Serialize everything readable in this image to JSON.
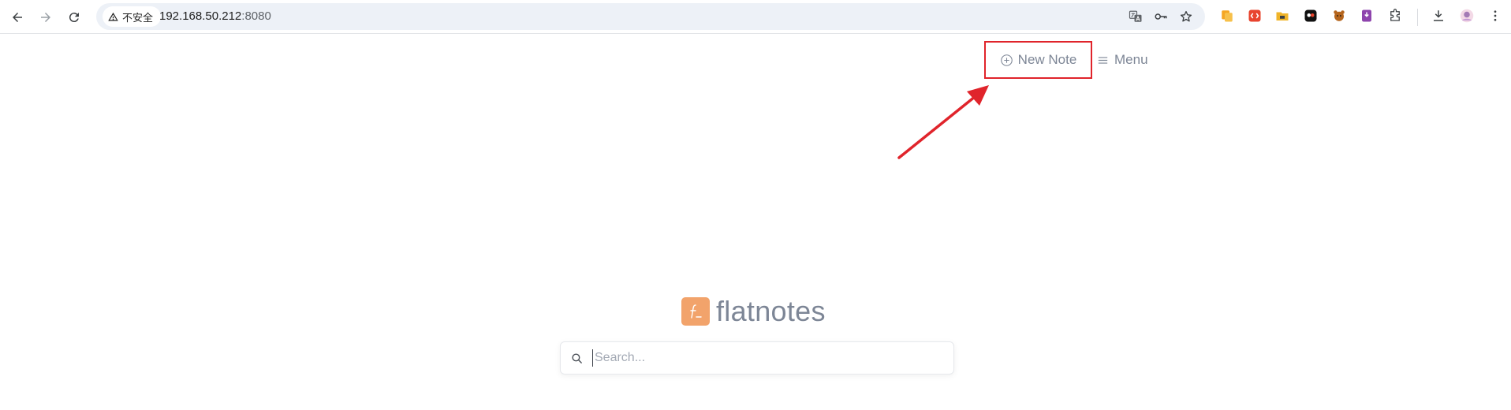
{
  "browser": {
    "security_label": "不安全",
    "url_host": "192.168.50.212",
    "url_port": ":8080"
  },
  "header": {
    "new_note_label": "New Note",
    "menu_label": "Menu"
  },
  "annotation": {
    "highlight_color": "#e0242b"
  },
  "logo": {
    "text": "flatnotes",
    "mark_color": "#f2a36b"
  },
  "search": {
    "placeholder": "Search..."
  }
}
